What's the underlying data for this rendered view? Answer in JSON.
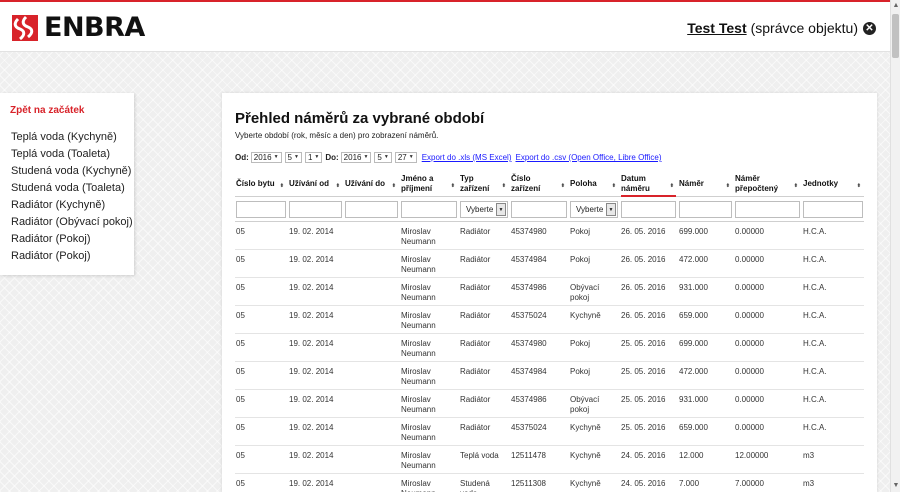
{
  "header": {
    "logo_text": "ENBRA",
    "user_name": "Test Test",
    "user_role": "(správce objektu)",
    "logout_glyph": "✕"
  },
  "sidebar": {
    "back_label": "Zpět na začátek",
    "items": [
      "Teplá voda (Kychyně)",
      "Teplá voda (Toaleta)",
      "Studená voda (Kychyně)",
      "Studená voda (Toaleta)",
      "Radiátor (Kychyně)",
      "Radiátor (Obývací pokoj)",
      "Radiátor (Pokoj)",
      "Radiátor (Pokoj)"
    ]
  },
  "main": {
    "title": "Přehled náměrů za vybrané období",
    "subtitle": "Vyberte období (rok, měsíc a den) pro zobrazení náměrů.",
    "filters": {
      "from_label": "Od:",
      "from_year": "2016",
      "from_month": "5",
      "from_day": "1",
      "to_label": "Do:",
      "to_year": "2016",
      "to_month": "5",
      "to_day": "27",
      "export_xls": "Export do .xls (MS Excel)",
      "export_csv": "Export do .csv (Open Office, Libre Office)"
    },
    "table": {
      "columns": [
        "Číslo bytu",
        "Užívání od",
        "Užívání do",
        "Jméno a příjmení",
        "Typ zařízení",
        "Číslo zařízení",
        "Poloha",
        "Datum náměru",
        "Náměr",
        "Náměr přepočtený",
        "Jednotky"
      ],
      "filter_select_label": "Vyberte",
      "rows": [
        [
          "05",
          "19. 02. 2014",
          "",
          "Miroslav Neumann",
          "Radiátor",
          "45374980",
          "Pokoj",
          "26. 05. 2016",
          "699.000",
          "0.00000",
          "H.C.A."
        ],
        [
          "05",
          "19. 02. 2014",
          "",
          "Miroslav Neumann",
          "Radiátor",
          "45374984",
          "Pokoj",
          "26. 05. 2016",
          "472.000",
          "0.00000",
          "H.C.A."
        ],
        [
          "05",
          "19. 02. 2014",
          "",
          "Miroslav Neumann",
          "Radiátor",
          "45374986",
          "Obývací pokoj",
          "26. 05. 2016",
          "931.000",
          "0.00000",
          "H.C.A."
        ],
        [
          "05",
          "19. 02. 2014",
          "",
          "Miroslav Neumann",
          "Radiátor",
          "45375024",
          "Kychyně",
          "26. 05. 2016",
          "659.000",
          "0.00000",
          "H.C.A."
        ],
        [
          "05",
          "19. 02. 2014",
          "",
          "Miroslav Neumann",
          "Radiátor",
          "45374980",
          "Pokoj",
          "25. 05. 2016",
          "699.000",
          "0.00000",
          "H.C.A."
        ],
        [
          "05",
          "19. 02. 2014",
          "",
          "Miroslav Neumann",
          "Radiátor",
          "45374984",
          "Pokoj",
          "25. 05. 2016",
          "472.000",
          "0.00000",
          "H.C.A."
        ],
        [
          "05",
          "19. 02. 2014",
          "",
          "Miroslav Neumann",
          "Radiátor",
          "45374986",
          "Obývací pokoj",
          "25. 05. 2016",
          "931.000",
          "0.00000",
          "H.C.A."
        ],
        [
          "05",
          "19. 02. 2014",
          "",
          "Miroslav Neumann",
          "Radiátor",
          "45375024",
          "Kychyně",
          "25. 05. 2016",
          "659.000",
          "0.00000",
          "H.C.A."
        ],
        [
          "05",
          "19. 02. 2014",
          "",
          "Miroslav Neumann",
          "Teplá voda",
          "12511478",
          "Kychyně",
          "24. 05. 2016",
          "12.000",
          "12.00000",
          "m3"
        ],
        [
          "05",
          "19. 02. 2014",
          "",
          "Miroslav Neumann",
          "Studená voda",
          "12511308",
          "Kychyně",
          "24. 05. 2016",
          "7.000",
          "7.00000",
          "m3"
        ]
      ]
    }
  },
  "colors": {
    "brand_red": "#d8232a",
    "link_blue": "#1a1aff"
  }
}
